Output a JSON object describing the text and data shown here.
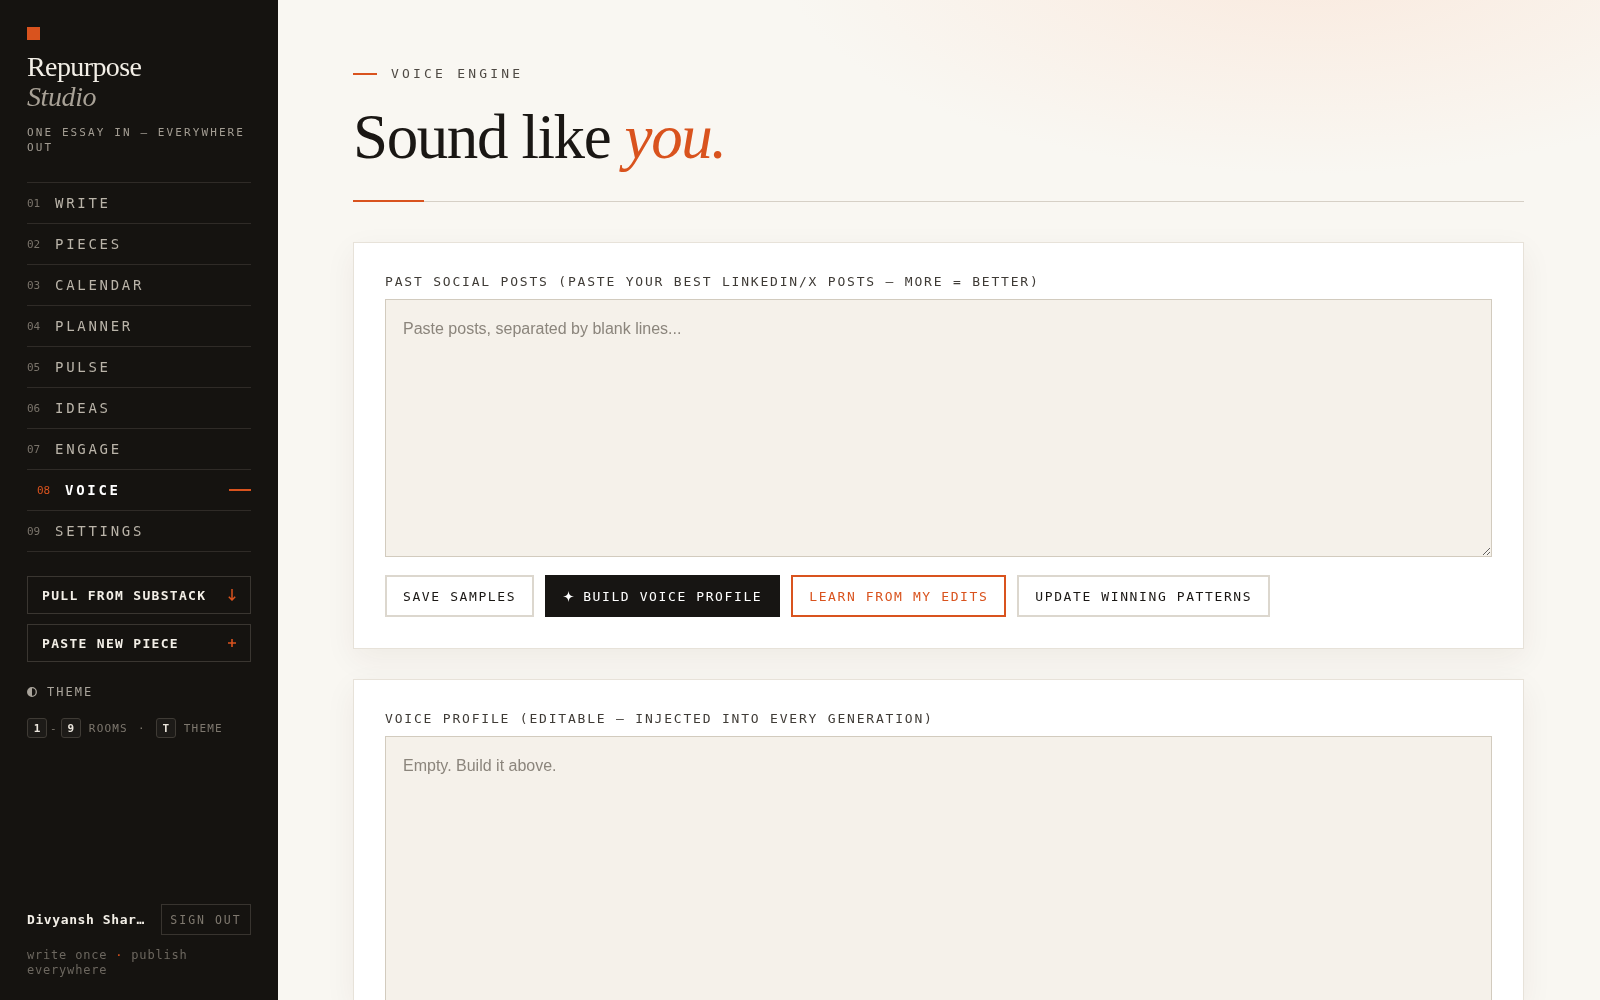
{
  "sidebar": {
    "brand": {
      "name": "Repurpose",
      "subtitle": "Studio",
      "tagline": "ONE ESSAY IN — EVERYWHERE OUT"
    },
    "nav": [
      {
        "number": "01",
        "label": "WRITE",
        "selected": false
      },
      {
        "number": "02",
        "label": "PIECES",
        "selected": false
      },
      {
        "number": "03",
        "label": "CALENDAR",
        "selected": false
      },
      {
        "number": "04",
        "label": "PLANNER",
        "selected": false
      },
      {
        "number": "05",
        "label": "PULSE",
        "selected": false
      },
      {
        "number": "06",
        "label": "IDEAS",
        "selected": false
      },
      {
        "number": "07",
        "label": "ENGAGE",
        "selected": false
      },
      {
        "number": "08",
        "label": "VOICE",
        "selected": true
      },
      {
        "number": "09",
        "label": "SETTINGS",
        "selected": false
      }
    ],
    "actions": [
      {
        "kind": "download",
        "label": "PULL FROM SUBSTACK"
      },
      {
        "kind": "add",
        "label": "PASTE NEW PIECE"
      }
    ],
    "theme_toggle": {
      "label": "THEME"
    },
    "shortcuts": [
      {
        "kind": "key",
        "text": "1"
      },
      {
        "kind": "joiner",
        "text": "-"
      },
      {
        "kind": "key",
        "text": "9"
      },
      {
        "kind": "text",
        "text": "ROOMS"
      },
      {
        "kind": "text",
        "text": "·"
      },
      {
        "kind": "key",
        "text": "T"
      },
      {
        "kind": "text",
        "text": "THEME"
      }
    ],
    "user": {
      "name": "Divyansh Shar…",
      "sign_out": "SIGN OUT"
    },
    "footer_note": {
      "before": "write once",
      "separator": "·",
      "after": "publish everywhere"
    }
  },
  "header": {
    "eyebrow": "VOICE ENGINE",
    "title": "Sound like *you.*"
  },
  "cards": [
    {
      "label": "PAST SOCIAL POSTS (PASTE YOUR BEST LINKEDIN/X POSTS — MORE = BETTER)",
      "placeholder": "Paste posts, separated by blank lines...",
      "buttons": [
        {
          "kind": "outline",
          "label": "SAVE SAMPLES"
        },
        {
          "kind": "primary",
          "label": "BUILD VOICE PROFILE"
        },
        {
          "kind": "accent",
          "label": "LEARN FROM MY EDITS"
        },
        {
          "kind": "outline",
          "label": "UPDATE WINNING PATTERNS"
        }
      ]
    },
    {
      "label": "VOICE PROFILE (EDITABLE — INJECTED INTO EVERY GENERATION)",
      "placeholder": "Empty. Build it above."
    }
  ]
}
